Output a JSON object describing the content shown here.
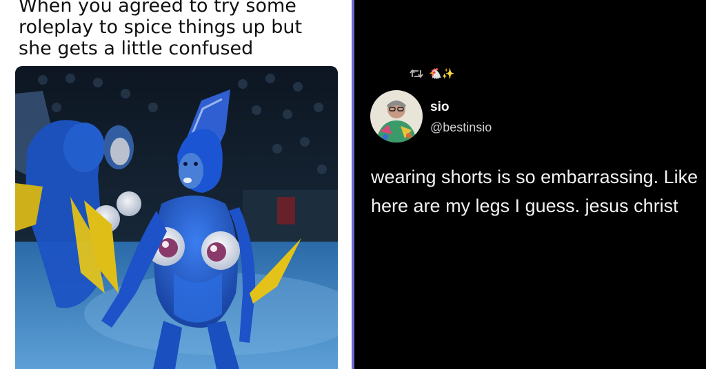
{
  "meme": {
    "caption": "When you agreed to try some\nroleplay to spice things up but\nshe gets a little confused",
    "photo_icon": "ice-show-photo"
  },
  "tweet": {
    "retweet_icon": "retweet-icon",
    "retweet_emojis": "🐔✨",
    "display_name": "sio",
    "handle": "@bestinsio",
    "avatar_icon": "profile-avatar",
    "text": "wearing shorts is so embarrassing. Like here are my legs I guess. jesus christ"
  },
  "colors": {
    "divider": "#6d6ad6",
    "tweet_background": "#000000",
    "costume_blue": "#1f5fd6",
    "fin_yellow": "#e4c21a"
  }
}
